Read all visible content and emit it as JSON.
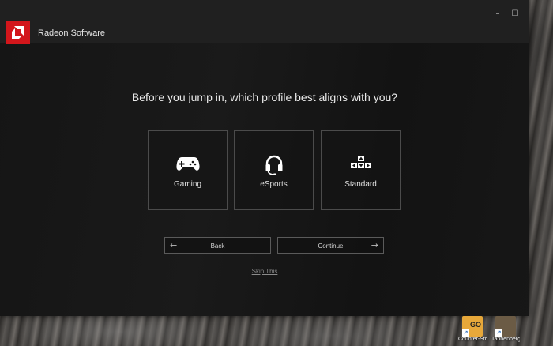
{
  "window": {
    "title": "Radeon Software",
    "controls": {
      "minimize": "–",
      "maximize": "☐",
      "close": "✕"
    }
  },
  "onboarding": {
    "question": "Before you jump in, which profile best aligns with you?",
    "profiles": [
      {
        "label": "Gaming",
        "icon": "gamepad-icon"
      },
      {
        "label": "eSports",
        "icon": "headset-icon"
      },
      {
        "label": "Standard",
        "icon": "keyboard-icon"
      }
    ],
    "back_label": "Back",
    "continue_label": "Continue",
    "skip_label": "Skip This"
  },
  "desktop": {
    "shortcuts": [
      {
        "label": "Counter-Stri...",
        "icon": "csgo-icon"
      },
      {
        "label": "Tannenberg",
        "icon": "tannenberg-icon"
      }
    ]
  },
  "colors": {
    "accent": "#d3161b",
    "window_bg": "#151515",
    "titlebar": "#202020"
  }
}
